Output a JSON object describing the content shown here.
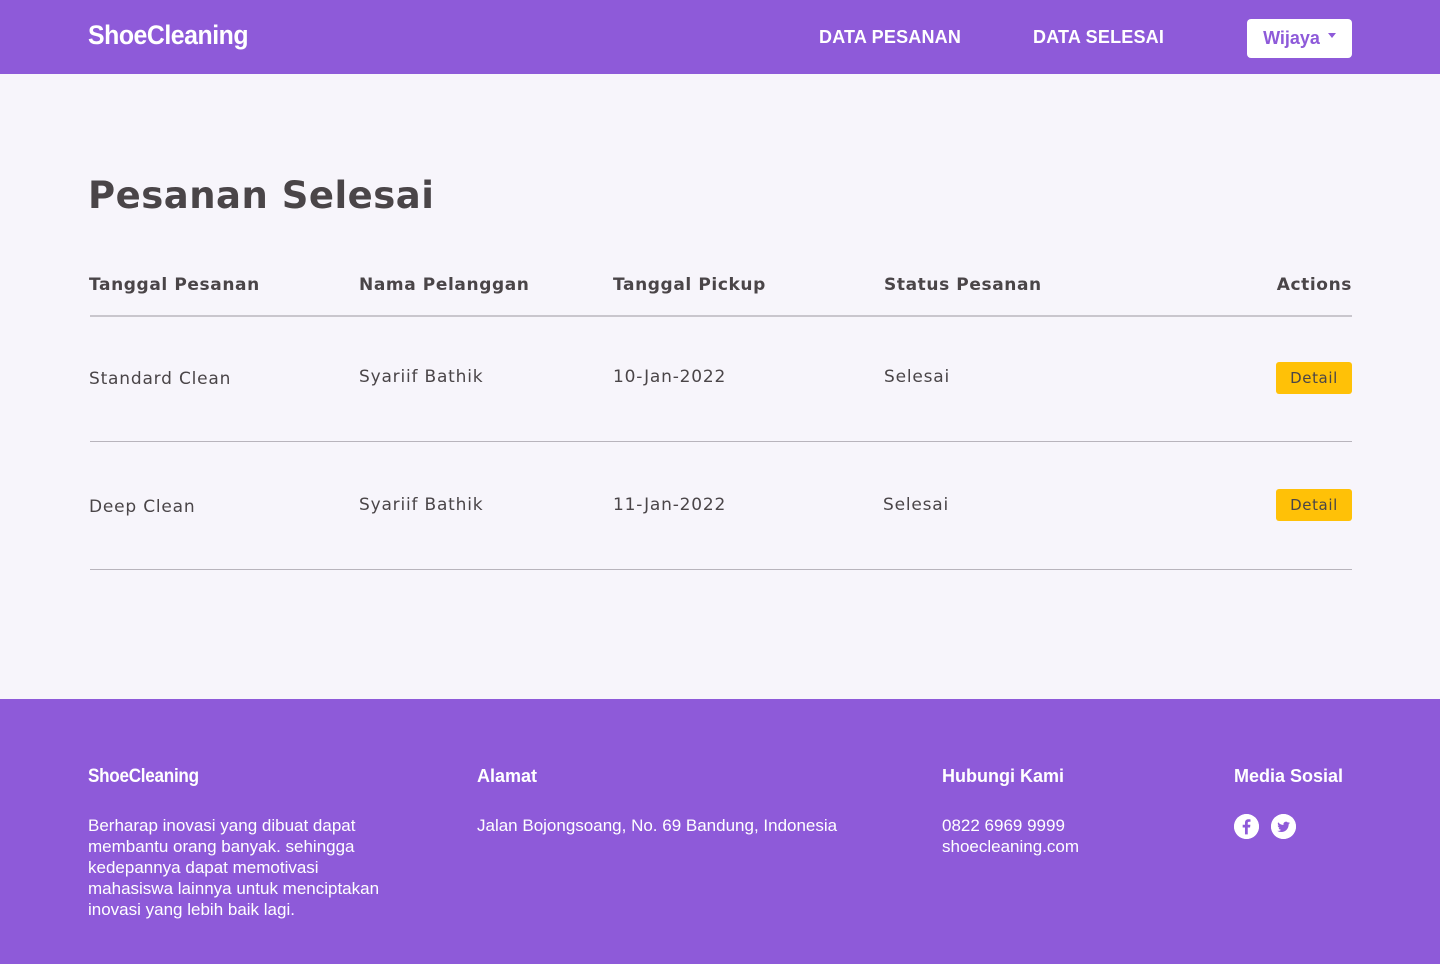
{
  "navbar": {
    "brand": "ShoeCleaning",
    "links": [
      "DATA PESANAN",
      "DATA SELESAI"
    ],
    "user": "Wijaya"
  },
  "main": {
    "title": "Pesanan Selesai",
    "columns": [
      "Tanggal Pesanan",
      "Nama Pelanggan",
      "Tanggal Pickup",
      "Status Pesanan",
      "Actions"
    ],
    "rows": [
      {
        "service": "Standard Clean",
        "customer": "Syariif Bathik",
        "pickup": "10-Jan-2022",
        "status": "Selesai",
        "action": "Detail"
      },
      {
        "service": "Deep Clean",
        "customer": "Syariif Bathik",
        "pickup": "11-Jan-2022",
        "status": "Selesai",
        "action": "Detail"
      }
    ]
  },
  "footer": {
    "brand": "ShoeCleaning",
    "description": "Berharap inovasi yang dibuat dapat membantu orang banyak. sehingga kedepannya dapat memotivasi mahasiswa lainnya untuk menciptakan inovasi yang lebih baik lagi.",
    "address_heading": "Alamat",
    "address": "Jalan Bojongsoang, No. 69 Bandung, Indonesia",
    "contact_heading": "Hubungi Kami",
    "phone": "0822 6969 9999",
    "website": "shoecleaning.com",
    "social_heading": "Media Sosial",
    "social_icons": [
      "facebook-icon",
      "twitter-icon"
    ]
  },
  "colors": {
    "primary": "#8e5ad9",
    "background": "#f7f5fb",
    "text": "#4a4548",
    "button": "#ffc107"
  }
}
